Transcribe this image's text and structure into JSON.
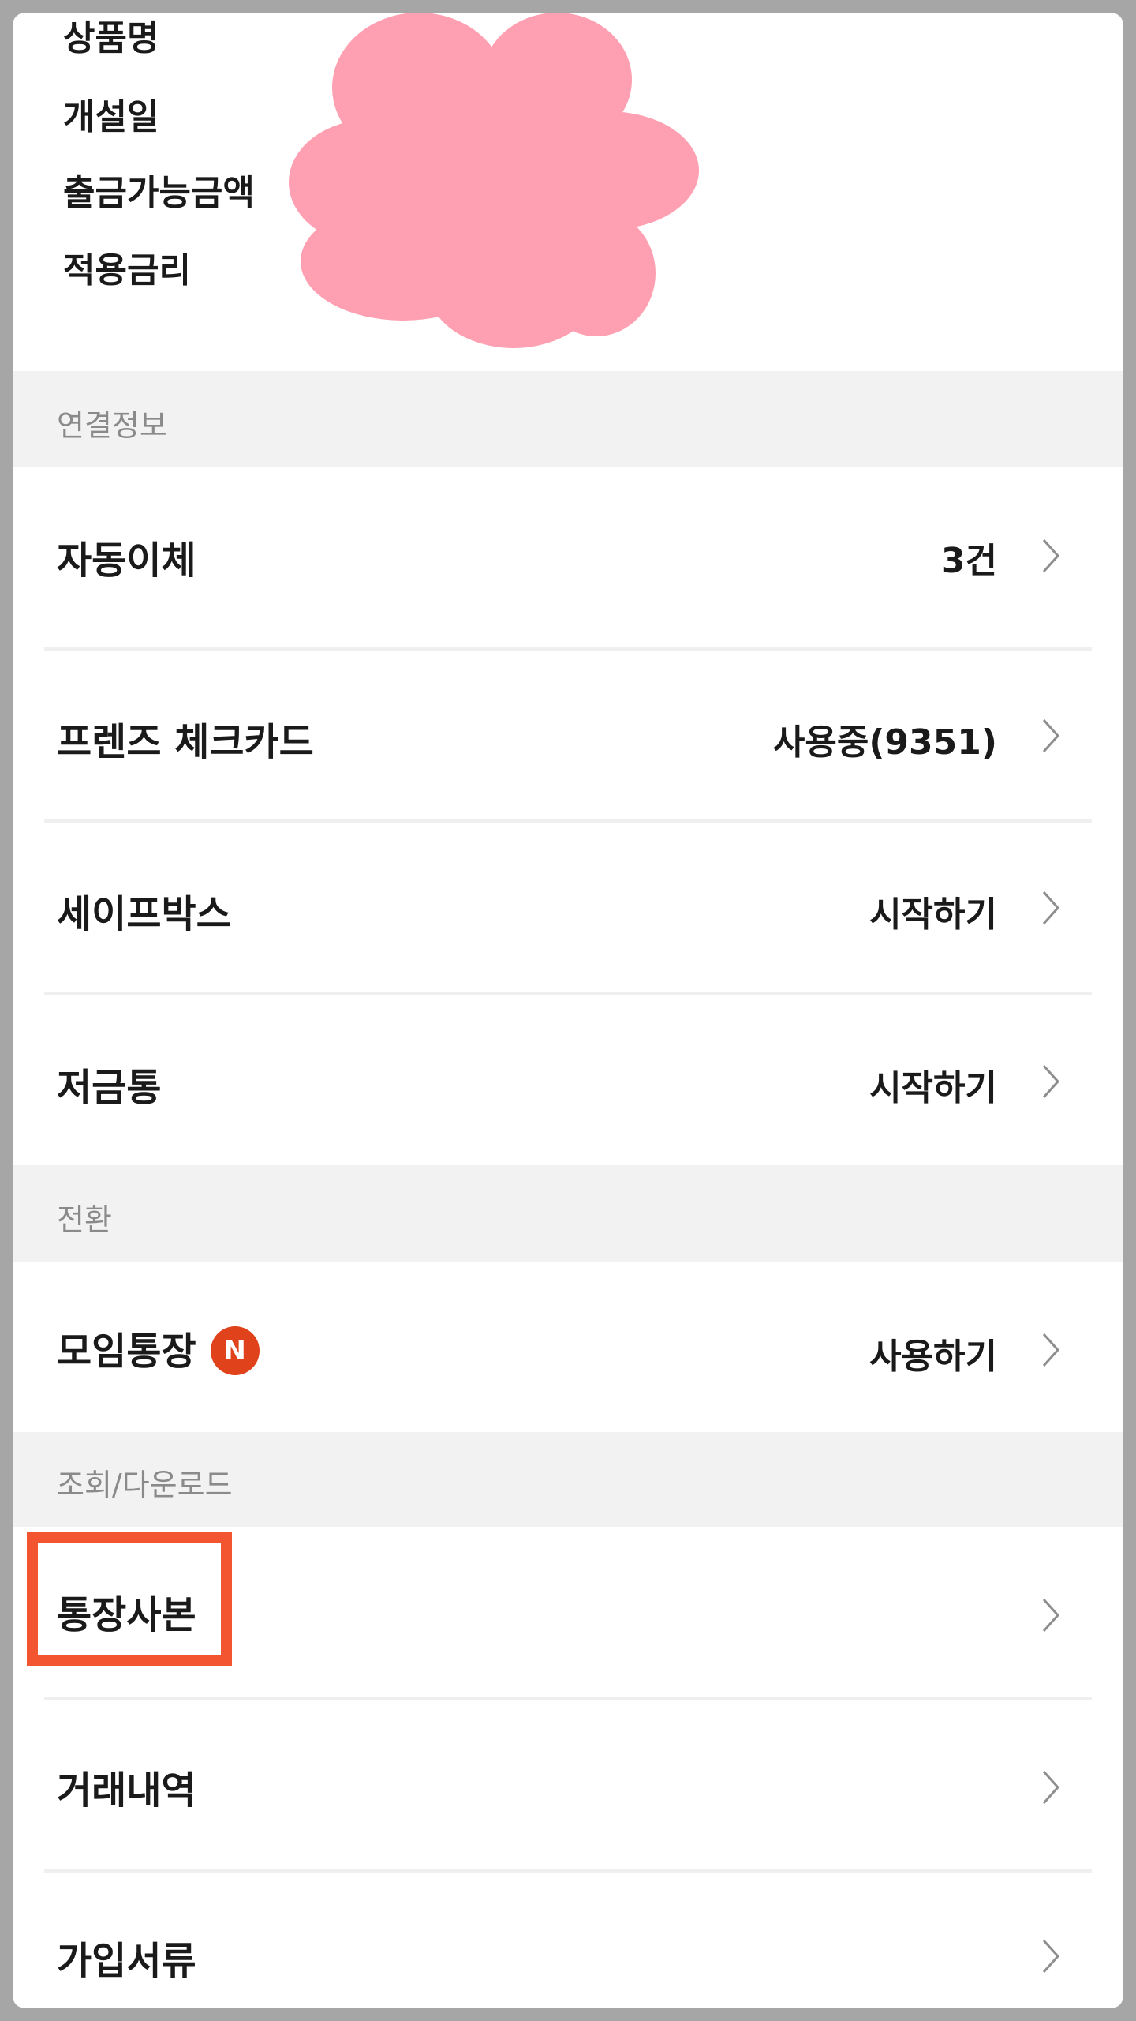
{
  "info": {
    "labels": [
      "상품명",
      "개설일",
      "출금가능금액",
      "적용금리"
    ]
  },
  "sections": {
    "connection": "연결정보",
    "conversion": "전환",
    "inquiry": "조회/다운로드"
  },
  "rows": {
    "autotransfer": {
      "label": "자동이체",
      "value": "3건"
    },
    "friends_card": {
      "label": "프렌즈 체크카드",
      "value": "사용중(9351)"
    },
    "safebox": {
      "label": "세이프박스",
      "value": "시작하기"
    },
    "piggybank": {
      "label": "저금통",
      "value": "시작하기"
    },
    "group_account": {
      "label": "모임통장",
      "badge": "N",
      "value": "사용하기"
    },
    "bankbook_copy": {
      "label": "통장사본"
    },
    "transactions": {
      "label": "거래내역"
    },
    "documents": {
      "label": "가입서류"
    }
  },
  "colors": {
    "badge": "#e0421b",
    "highlight": "#f2552f",
    "redaction": "#ff9fb2"
  },
  "icons": {
    "row_arrow": "chevron-right-icon"
  }
}
